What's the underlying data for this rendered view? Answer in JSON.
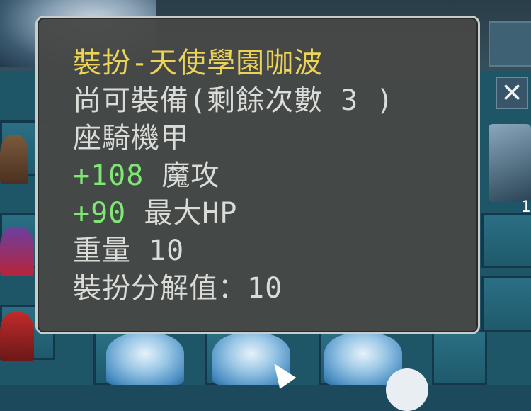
{
  "tooltip": {
    "title": "裝扮-天使學園咖波",
    "equip_status": "尚可裝備(剩餘次數 3 )",
    "category": "座騎機甲",
    "stats": [
      {
        "value": "+108",
        "name": "魔攻"
      },
      {
        "value": "+90",
        "name": "最大HP"
      }
    ],
    "weight": "重量 10",
    "decompose": "裝扮分解值：10"
  },
  "background": {
    "close_symbol": "✕",
    "side_count": "1"
  },
  "colors": {
    "title": "#ecd257",
    "stat_value": "#7ee873",
    "text": "#dadcd8",
    "tooltip_bg": "#464846",
    "tooltip_border": "#c8ccca"
  }
}
